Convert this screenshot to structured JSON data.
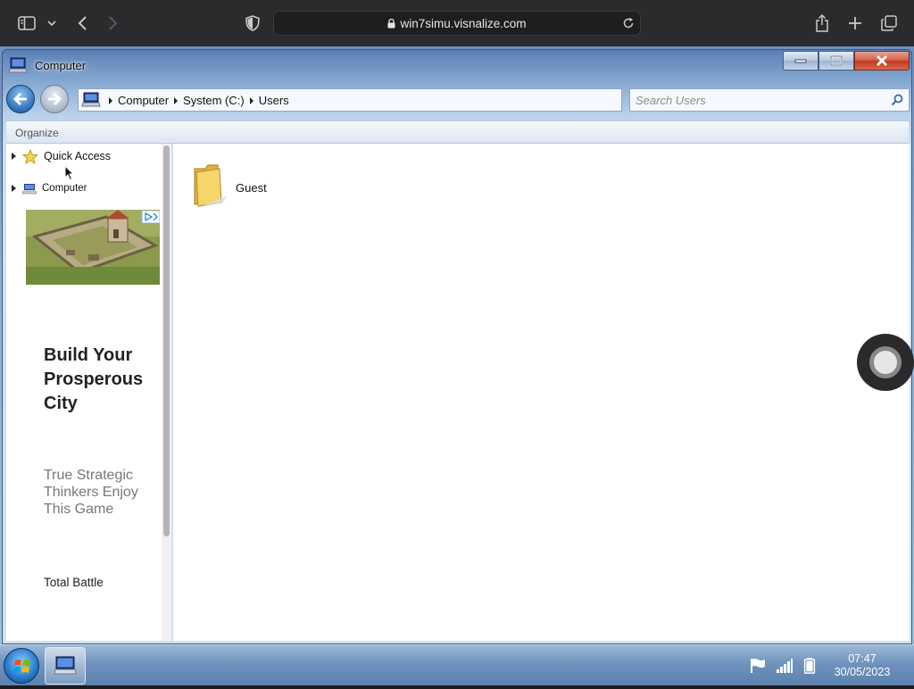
{
  "browser": {
    "url": "win7simu.visnalize.com",
    "icons": [
      "sidebar-icon",
      "chevron-down-icon",
      "back-icon",
      "forward-icon",
      "shield-icon",
      "reload-icon",
      "share-icon",
      "new-tab-icon",
      "tabs-overview-icon"
    ]
  },
  "window": {
    "title": "Computer",
    "controls": [
      "minimize",
      "maximize",
      "close"
    ]
  },
  "address": {
    "crumbs": [
      "Computer",
      "System (C:)",
      "Users"
    ]
  },
  "search": {
    "placeholder": "Search Users"
  },
  "toolbar": {
    "organize_label": "Organize"
  },
  "nav_tree": {
    "items": [
      {
        "label": "Quick Access",
        "icon": "star-icon"
      },
      {
        "label": "Computer",
        "icon": "computer-icon"
      }
    ]
  },
  "ad": {
    "headline": "Build Your Prosperous City",
    "subtext": "True Strategic Thinkers Enjoy This Game",
    "brand": "Total Battle"
  },
  "content": {
    "items": [
      {
        "label": "Guest",
        "icon": "folder-icon"
      }
    ]
  },
  "taskbar": {
    "clock_time": "07:47",
    "clock_date": "30/05/2023",
    "tray_icons": [
      "flag-icon",
      "signal-icon",
      "battery-icon"
    ]
  },
  "colors": {
    "browser_bg": "#2b2b2d",
    "window_frame": "#7ea2cd",
    "close_button": "#c23a1f",
    "taskbar": "#6f93bd"
  }
}
